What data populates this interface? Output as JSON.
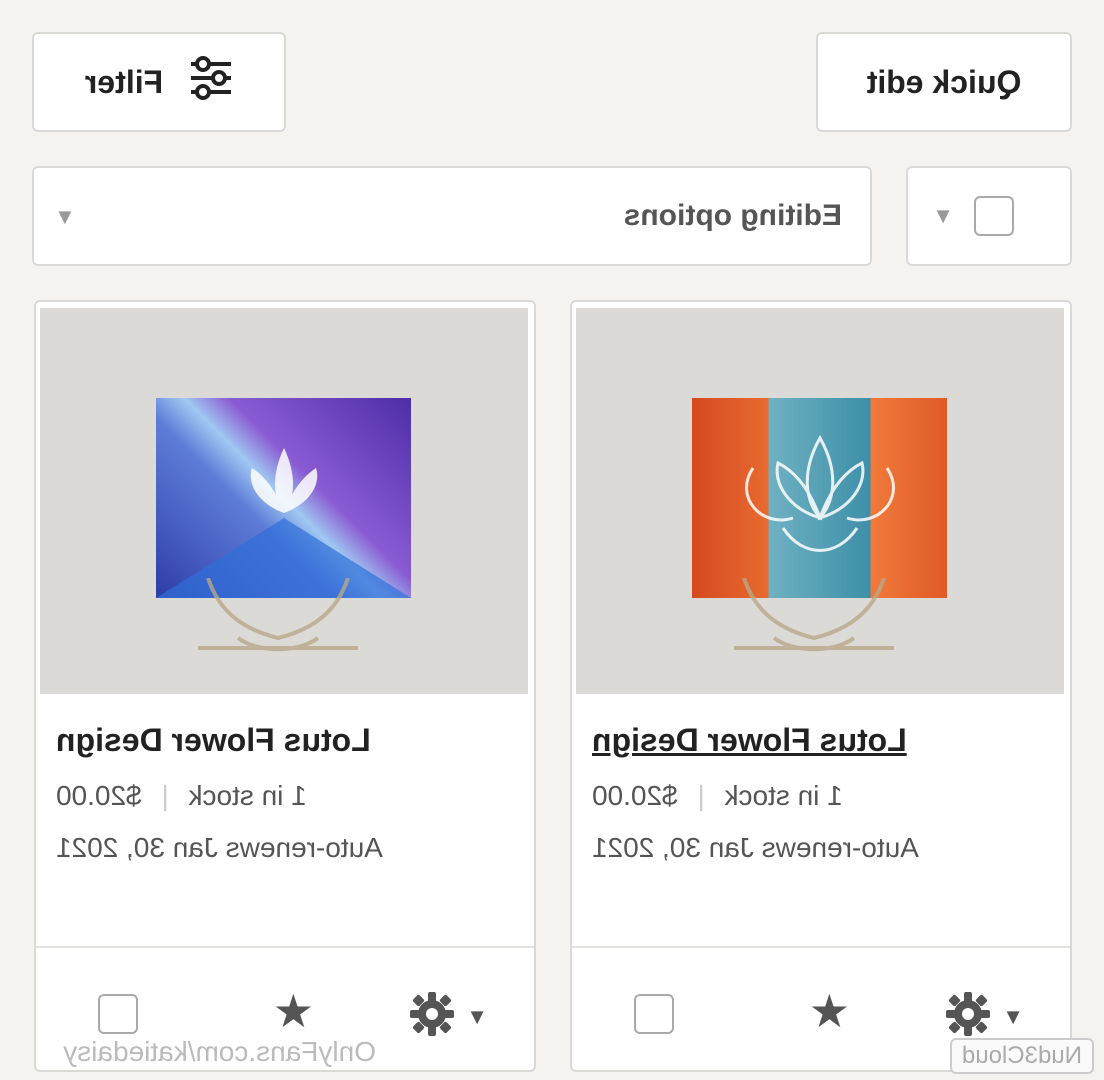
{
  "toolbar": {
    "filter_label": "Filter",
    "quick_edit_label": "Quick edit"
  },
  "editing": {
    "dropdown_label": "Editing options"
  },
  "listings": [
    {
      "title": "Lotus Flower Design",
      "stock": "1 in stock",
      "price": "$20.00",
      "renew": "Auto-renews Jan 30, 2021"
    },
    {
      "title": "Lotus Flower Design",
      "stock": "1 in stock",
      "price": "$20.00",
      "renew": "Auto-renews Jan 30, 2021"
    }
  ],
  "watermarks": {
    "left": "OnlyFans.com/katiedaisy",
    "right": "Nud3Cloud"
  },
  "icons": {
    "filter": "sliders-icon",
    "star": "star-icon",
    "gear": "gear-icon",
    "caret": "caret-down-icon"
  }
}
